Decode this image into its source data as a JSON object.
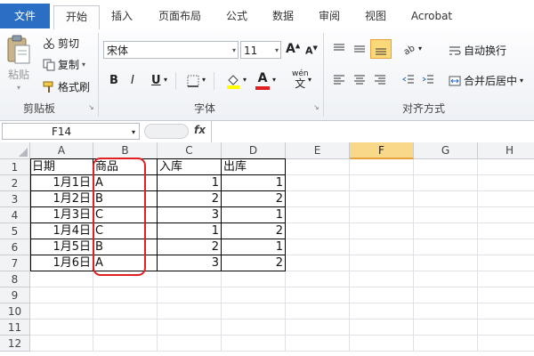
{
  "tabs": {
    "file": "文件",
    "home": "开始",
    "insert": "插入",
    "page_layout": "页面布局",
    "formulas": "公式",
    "data": "数据",
    "review": "审阅",
    "view": "视图",
    "acrobat": "Acrobat"
  },
  "clipboard": {
    "paste": "粘贴",
    "cut": "剪切",
    "copy": "复制",
    "format_painter": "格式刷",
    "group_label": "剪贴板"
  },
  "font": {
    "name": "宋体",
    "size": "11",
    "grow": "A",
    "shrink": "A",
    "bold": "B",
    "italic": "I",
    "underline": "U",
    "font_color_letter": "A",
    "wen_label": "wén",
    "wen_char": "文",
    "group_label": "字体"
  },
  "alignment": {
    "wrap_text": "自动换行",
    "merge_center": "合并后居中",
    "group_label": "对齐方式"
  },
  "formula_bar": {
    "name_box": "F14",
    "fx": "fx",
    "value": ""
  },
  "sheet": {
    "columns": [
      "A",
      "B",
      "C",
      "D",
      "E",
      "F",
      "G",
      "H"
    ],
    "selected_column": "F",
    "rows": [
      "1",
      "2",
      "3",
      "4",
      "5",
      "6",
      "7",
      "8",
      "9",
      "10",
      "11",
      "12"
    ],
    "headers": [
      "日期",
      "商品",
      "入库",
      "出库"
    ],
    "records": [
      {
        "date": "1月1日",
        "item": "A",
        "in": "1",
        "out": "1"
      },
      {
        "date": "1月2日",
        "item": "B",
        "in": "2",
        "out": "2"
      },
      {
        "date": "1月3日",
        "item": "C",
        "in": "3",
        "out": "1"
      },
      {
        "date": "1月4日",
        "item": "C",
        "in": "1",
        "out": "2"
      },
      {
        "date": "1月5日",
        "item": "B",
        "in": "2",
        "out": "1"
      },
      {
        "date": "1月6日",
        "item": "A",
        "in": "3",
        "out": "2"
      }
    ]
  },
  "colors": {
    "file_tab": "#2a6fc4",
    "selected_column_header": "#f8d98a",
    "highlight_outline": "#e02020",
    "font_color_bar": "#e02020",
    "fill_color_bar": "#ffff00"
  }
}
